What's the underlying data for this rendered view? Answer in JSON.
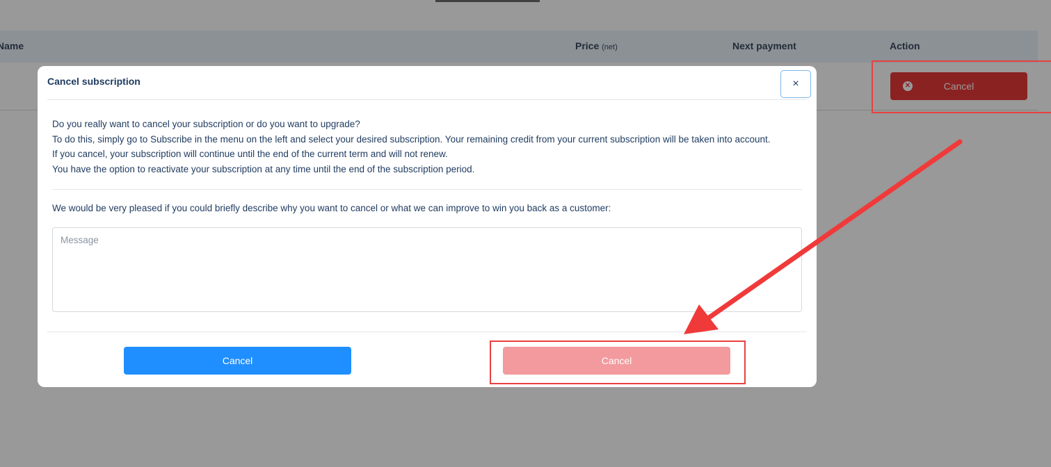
{
  "table": {
    "headers": {
      "name": "Name",
      "price": "Price",
      "price_suffix": "(net)",
      "next_payment": "Next payment",
      "action": "Action"
    },
    "row_cancel_label": "Cancel"
  },
  "modal": {
    "title": "Cancel subscription",
    "close_glyph": "×",
    "paragraphs": [
      "Do you really want to cancel your subscription or do you want to upgrade?",
      "To do this, simply go to Subscribe in the menu on the left and select your desired subscription. Your remaining credit from your current subscription will be taken into account.",
      "If you cancel, your subscription will continue until the end of the current term and will not renew.",
      "You have the option to reactivate your subscription at any time until the end of the subscription period."
    ],
    "prompt": "We would be very pleased if you could briefly describe why you want to cancel or what we can improve to win you back as a customer:",
    "message_placeholder": "Message",
    "keep_button_label": "Cancel",
    "confirm_button_label": "Cancel"
  },
  "colors": {
    "primary_blue": "#1f8fff",
    "danger_red": "#e83a3a",
    "danger_disabled": "#f29a9d",
    "annotation_red": "#e8403f",
    "text_navy": "#1e3a5f"
  },
  "icons": {
    "close": "close-icon",
    "row_cancel": "x-circle-icon",
    "annotation": "arrow-annotation"
  }
}
